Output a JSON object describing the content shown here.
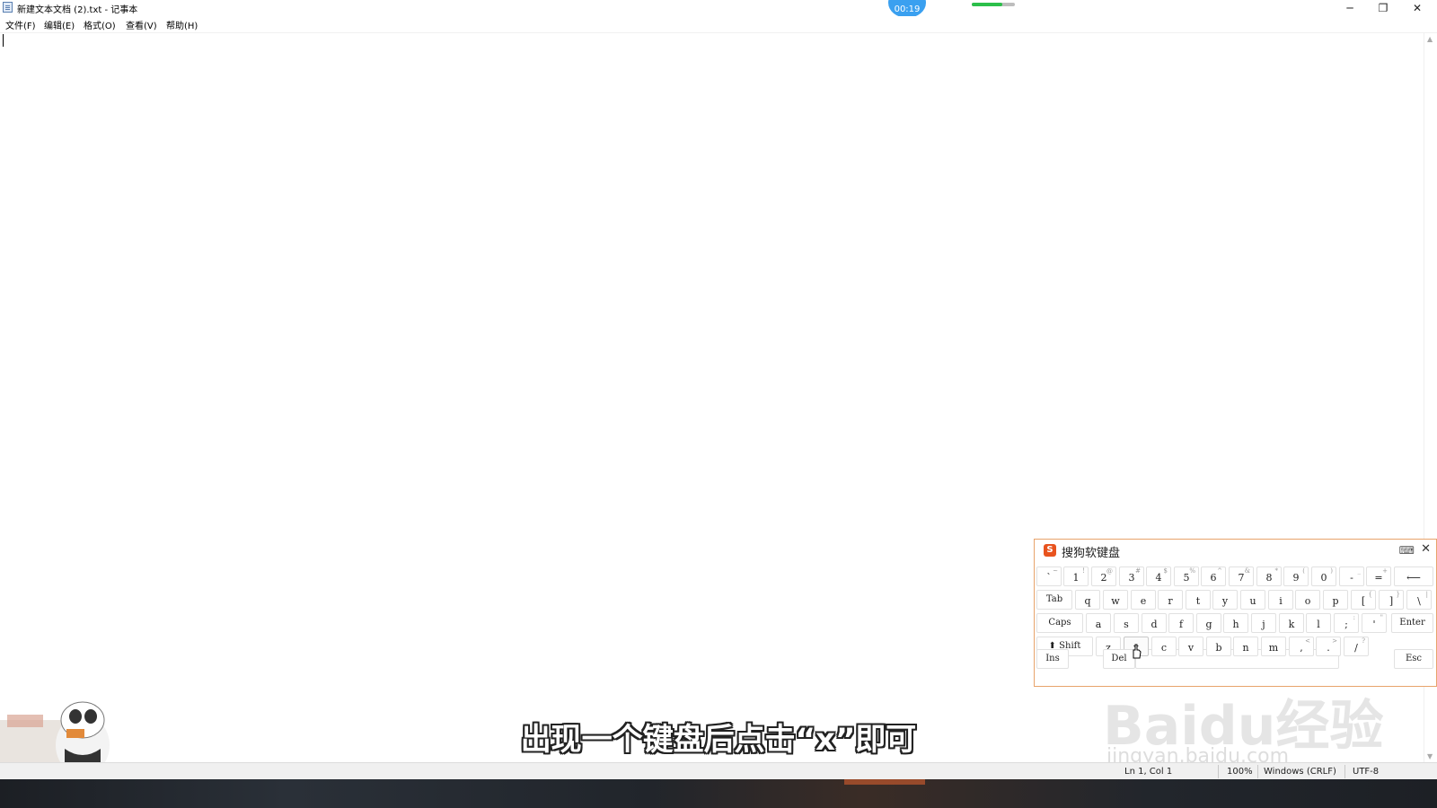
{
  "window": {
    "title": "新建文本文档 (2).txt - 记事本",
    "controls": {
      "minimize": "─",
      "restore": "❐",
      "close": "✕"
    }
  },
  "overlay": {
    "timer": "00:19",
    "progress": 0.7,
    "subtitle": "出现一个键盘后点击“x”即可",
    "watermark": "Baidu经验",
    "watermark_url": "jingyan.baidu.com"
  },
  "menu": {
    "file": "文件(F)",
    "edit": "编辑(E)",
    "format": "格式(O)",
    "view": "查看(V)",
    "help": "帮助(H)"
  },
  "status": {
    "position": "Ln 1, Col 1",
    "zoom": "100%",
    "line_ending": "Windows (CRLF)",
    "encoding": "UTF-8"
  },
  "keyboard": {
    "title": "搜狗软键盘",
    "logo": "S",
    "switch_icon": "⌨",
    "close_icon": "✕",
    "rows": {
      "r1": [
        {
          "main": "`",
          "sub": "~"
        },
        {
          "main": "1",
          "sub": "!"
        },
        {
          "main": "2",
          "sub": "@"
        },
        {
          "main": "3",
          "sub": "#"
        },
        {
          "main": "4",
          "sub": "$"
        },
        {
          "main": "5",
          "sub": "%"
        },
        {
          "main": "6",
          "sub": "^"
        },
        {
          "main": "7",
          "sub": "&"
        },
        {
          "main": "8",
          "sub": "*"
        },
        {
          "main": "9",
          "sub": "("
        },
        {
          "main": "0",
          "sub": ")"
        },
        {
          "main": "-",
          "sub": "_"
        },
        {
          "main": "=",
          "sub": "+"
        },
        {
          "main": "⟵",
          "sub": ""
        }
      ],
      "r2": [
        {
          "main": "Tab",
          "sub": ""
        },
        {
          "main": "q",
          "sub": ""
        },
        {
          "main": "w",
          "sub": ""
        },
        {
          "main": "e",
          "sub": ""
        },
        {
          "main": "r",
          "sub": ""
        },
        {
          "main": "t",
          "sub": ""
        },
        {
          "main": "y",
          "sub": ""
        },
        {
          "main": "u",
          "sub": ""
        },
        {
          "main": "i",
          "sub": ""
        },
        {
          "main": "o",
          "sub": ""
        },
        {
          "main": "p",
          "sub": ""
        },
        {
          "main": "[",
          "sub": "{"
        },
        {
          "main": "]",
          "sub": "}"
        },
        {
          "main": "\\",
          "sub": "|"
        }
      ],
      "r3": [
        {
          "main": "Caps",
          "sub": ""
        },
        {
          "main": "a",
          "sub": ""
        },
        {
          "main": "s",
          "sub": ""
        },
        {
          "main": "d",
          "sub": ""
        },
        {
          "main": "f",
          "sub": ""
        },
        {
          "main": "g",
          "sub": ""
        },
        {
          "main": "h",
          "sub": ""
        },
        {
          "main": "j",
          "sub": ""
        },
        {
          "main": "k",
          "sub": ""
        },
        {
          "main": "l",
          "sub": ""
        },
        {
          "main": ";",
          "sub": ":"
        },
        {
          "main": "'",
          "sub": "\""
        },
        {
          "main": "Enter",
          "sub": ""
        }
      ],
      "r4": [
        {
          "main": "⬆ Shift",
          "sub": ""
        },
        {
          "main": "z",
          "sub": ""
        },
        {
          "main": "x",
          "sub": ""
        },
        {
          "main": "c",
          "sub": ""
        },
        {
          "main": "v",
          "sub": ""
        },
        {
          "main": "b",
          "sub": ""
        },
        {
          "main": "n",
          "sub": ""
        },
        {
          "main": "m",
          "sub": ""
        },
        {
          "main": ",",
          "sub": "<"
        },
        {
          "main": ".",
          "sub": ">"
        },
        {
          "main": "/",
          "sub": "?"
        }
      ],
      "r5": [
        {
          "main": "Ins",
          "sub": ""
        },
        {
          "main": "Del",
          "sub": ""
        },
        {
          "main": "Esc",
          "sub": ""
        }
      ]
    }
  }
}
